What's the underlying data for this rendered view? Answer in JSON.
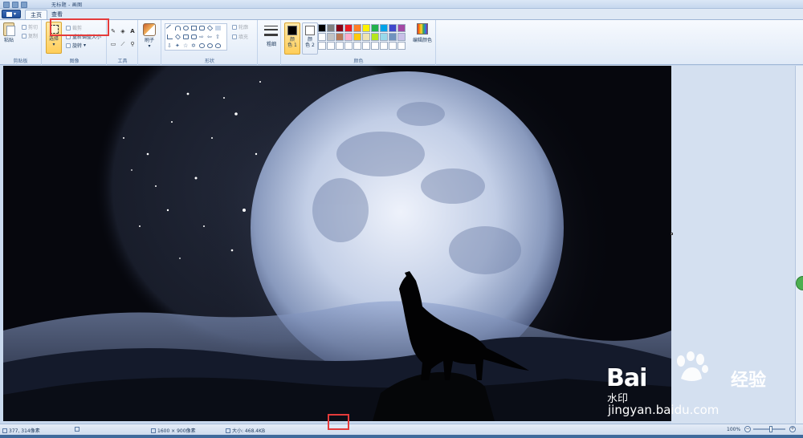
{
  "window": {
    "title": "无标题 - 画图"
  },
  "tabs": [
    {
      "label": "主页",
      "active": true
    },
    {
      "label": "查看",
      "active": false
    }
  ],
  "ribbon": {
    "clipboard": {
      "group_label": "剪贴板",
      "paste": "粘贴",
      "cut": "剪切",
      "copy": "复制"
    },
    "image": {
      "group_label": "图像",
      "select": "选择",
      "crop": "裁剪",
      "resize": "重新调整大小",
      "rotate": "旋转"
    },
    "tools": {
      "group_label": "工具"
    },
    "brushes": {
      "label": "刷子"
    },
    "shapes": {
      "group_label": "形状",
      "outline": "轮廓",
      "fill": "填充"
    },
    "size": {
      "label": "粗细"
    },
    "colors": {
      "group_label": "颜色",
      "color1": "颜\n色 1",
      "color2": "颜\n色 2",
      "edit": "编辑颜色",
      "color1_value": "#000000",
      "color2_value": "#ffffff",
      "palette": [
        "#000000",
        "#7f7f7f",
        "#880015",
        "#ed1c24",
        "#ff7f27",
        "#fff200",
        "#22b14c",
        "#00a2e8",
        "#3f48cc",
        "#a349a4",
        "#ffffff",
        "#c3c3c3",
        "#b97a57",
        "#ffaec9",
        "#ffc90e",
        "#efe4b0",
        "#b5e61d",
        "#99d9ea",
        "#7092be",
        "#c8bfe7",
        "#ffffff",
        "#ffffff",
        "#ffffff",
        "#ffffff",
        "#ffffff",
        "#ffffff",
        "#ffffff",
        "#ffffff",
        "#ffffff",
        "#ffffff"
      ]
    }
  },
  "watermark": {
    "brand": "Bai",
    "brand_cn": "经验",
    "url": "jingyan.baidu.com",
    "shuiyin": "水印"
  },
  "statusbar": {
    "cursor": "377, 314像素",
    "dimensions": "1600 × 900像素",
    "size": "大小: 468.4KB",
    "zoom": "100%"
  }
}
